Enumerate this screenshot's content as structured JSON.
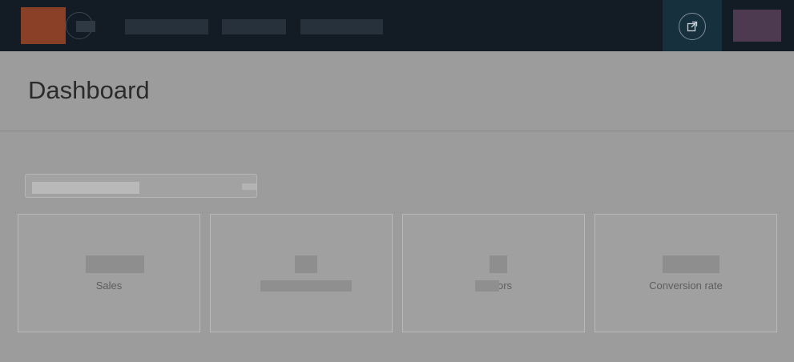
{
  "header": {
    "brand_color": "#8a3f27",
    "nav_items": [
      "",
      "",
      ""
    ],
    "external_link_icon": "external-link-icon"
  },
  "page": {
    "title": "Dashboard"
  },
  "filter": {
    "value": ""
  },
  "cards": [
    {
      "label": "Sales",
      "value": ""
    },
    {
      "label": "",
      "value": ""
    },
    {
      "label": "ors",
      "value": ""
    },
    {
      "label": "Conversion rate",
      "value": ""
    }
  ]
}
